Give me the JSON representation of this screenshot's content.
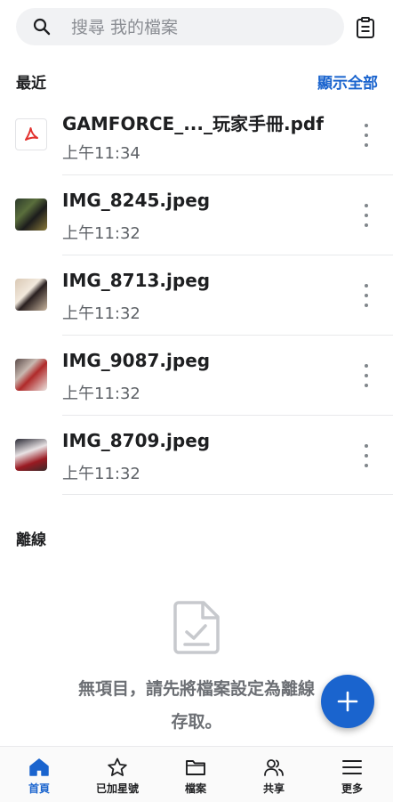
{
  "search": {
    "placeholder": "搜尋 我的檔案"
  },
  "recent": {
    "title": "最近",
    "show_all": "顯示全部",
    "files": [
      {
        "name": "GAMFORCE_..._玩家手冊.pdf",
        "time": "上午11:34",
        "type": "pdf"
      },
      {
        "name": "IMG_8245.jpeg",
        "time": "上午11:32",
        "type": "image"
      },
      {
        "name": "IMG_8713.jpeg",
        "time": "上午11:32",
        "type": "image"
      },
      {
        "name": "IMG_9087.jpeg",
        "time": "上午11:32",
        "type": "image"
      },
      {
        "name": "IMG_8709.jpeg",
        "time": "上午11:32",
        "type": "image"
      }
    ]
  },
  "offline": {
    "title": "離線",
    "empty_line1": "無項目，請先將檔案設定為離線",
    "empty_line2": "存取。"
  },
  "nav": [
    {
      "label": "首頁",
      "icon": "home-icon",
      "active": true
    },
    {
      "label": "已加星號",
      "icon": "star-icon",
      "active": false
    },
    {
      "label": "檔案",
      "icon": "folder-icon",
      "active": false
    },
    {
      "label": "共享",
      "icon": "people-icon",
      "active": false
    },
    {
      "label": "更多",
      "icon": "menu-icon",
      "active": false
    }
  ],
  "colors": {
    "accent": "#1a64ce",
    "pdf_red": "#e2302d"
  }
}
